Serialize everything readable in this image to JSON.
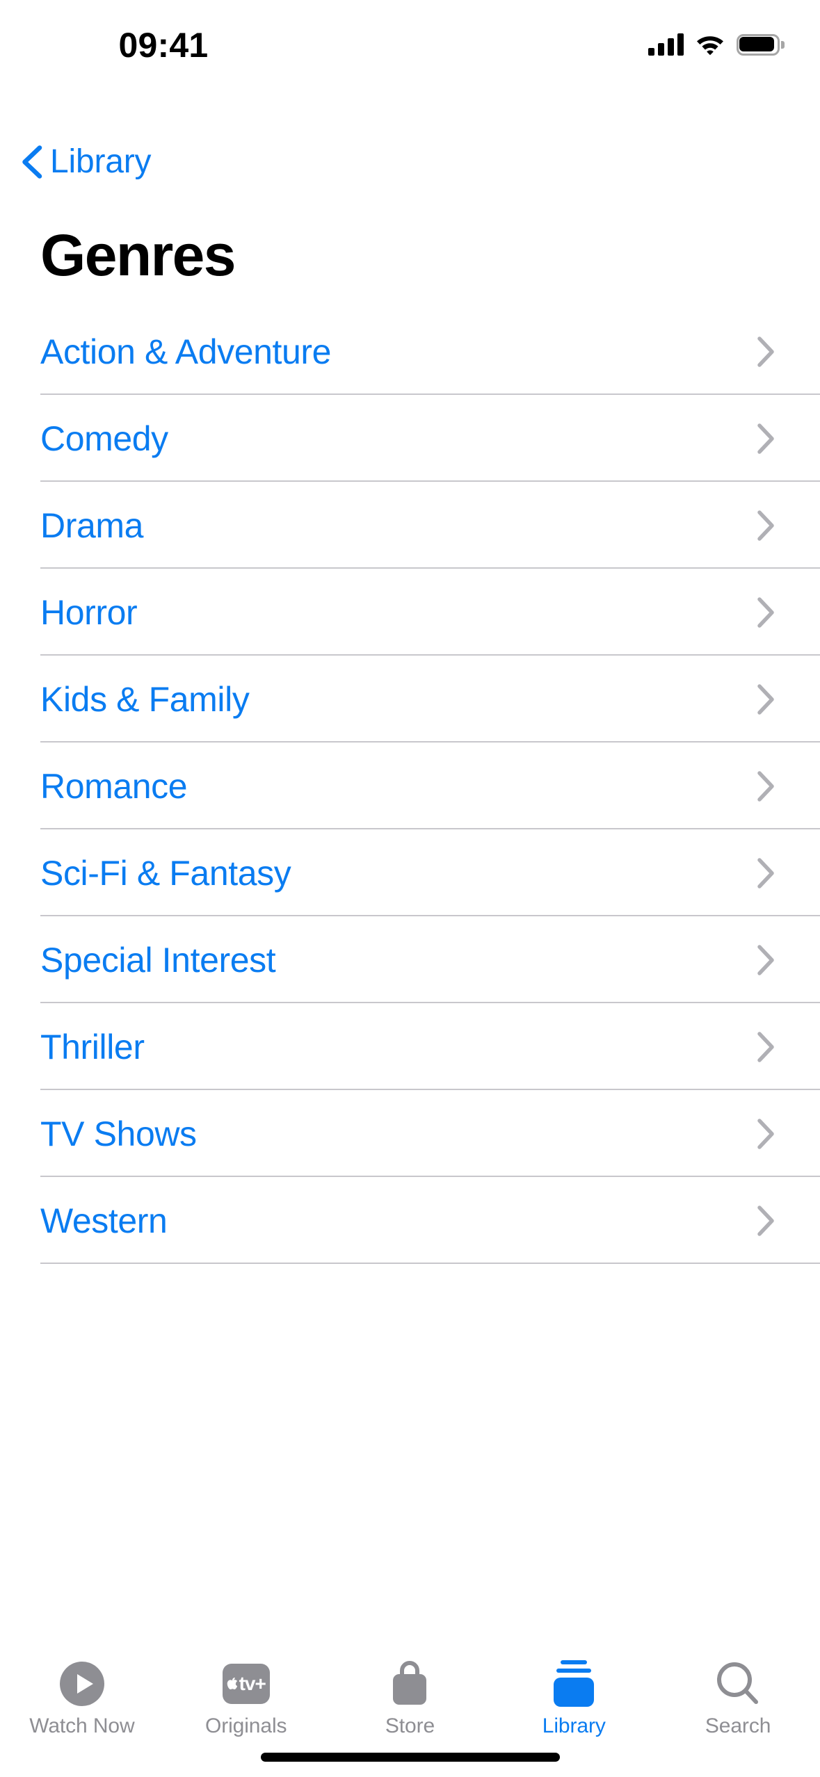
{
  "status_bar": {
    "time": "09:41",
    "cellular_icon": "cellular-bars-icon",
    "wifi_icon": "wifi-icon",
    "battery_icon": "battery-full-icon"
  },
  "nav": {
    "back_label": "Library",
    "back_icon": "chevron-left-icon",
    "title": "Genres"
  },
  "colors": {
    "accent_blue": "#0a7cf1",
    "inactive_gray": "#8e8e93",
    "separator": "#c8c7cc",
    "background": "#ffffff"
  },
  "list": {
    "disclosure_icon": "chevron-right-icon",
    "rows": [
      {
        "label": "Action & Adventure"
      },
      {
        "label": "Comedy"
      },
      {
        "label": "Drama"
      },
      {
        "label": "Horror"
      },
      {
        "label": "Kids & Family"
      },
      {
        "label": "Romance"
      },
      {
        "label": "Sci-Fi & Fantasy"
      },
      {
        "label": "Special Interest"
      },
      {
        "label": "Thriller"
      },
      {
        "label": "TV Shows"
      },
      {
        "label": "Western"
      }
    ]
  },
  "tab_bar": {
    "tabs": [
      {
        "label": "Watch Now",
        "icon": "play-circle-icon",
        "active": false
      },
      {
        "label": "Originals",
        "icon": "apple-tv-plus-icon",
        "active": false,
        "badge_text": "tv+"
      },
      {
        "label": "Store",
        "icon": "shopping-bag-icon",
        "active": false
      },
      {
        "label": "Library",
        "icon": "library-stack-icon",
        "active": true
      },
      {
        "label": "Search",
        "icon": "magnifying-glass-icon",
        "active": false
      }
    ]
  }
}
